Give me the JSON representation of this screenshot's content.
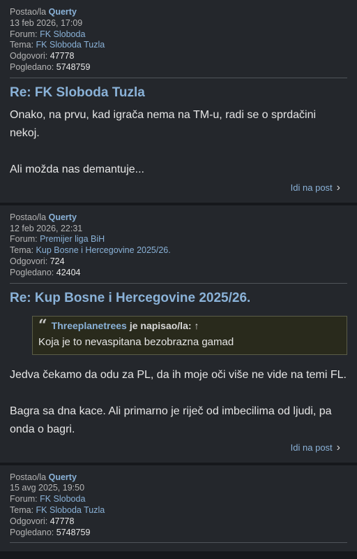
{
  "labels": {
    "posted_by": "Postao/la",
    "forum": "Forum:",
    "topic": "Tema:",
    "replies": "Odgovori:",
    "views": "Pogledano:",
    "goto": "Idi na post",
    "wrote": "je napisao/la:"
  },
  "posts": [
    {
      "author": "Querty",
      "date": "13 feb 2026, 17:09",
      "forum": "FK Sloboda",
      "topic": "FK Sloboda Tuzla",
      "replies": "47778",
      "views": "5748759",
      "title": "Re: FK Sloboda Tuzla",
      "body": [
        "Onako, na prvu, kad igrača nema na TM-u, radi se o sprdačini nekoj.",
        "Ali možda nas demantuje..."
      ]
    },
    {
      "author": "Querty",
      "date": "12 feb 2026, 22:31",
      "forum": "Premijer liga BiH",
      "topic": "Kup Bosne i Hercegovine 2025/26.",
      "replies": "724",
      "views": "42404",
      "title": "Re: Kup Bosne i Hercegovine 2025/26.",
      "quote": {
        "author": "Threeplanetrees",
        "text": "Koja je to nevaspitana bezobrazna gamad"
      },
      "body": [
        "Jedva čekamo da odu za PL, da ih moje oči više ne vide na temi FL.",
        "Bagra sa dna kace. Ali primarno je riječ od imbecilima od ljudi, pa onda o bagri."
      ]
    },
    {
      "author": "Querty",
      "date": "15 avg 2025, 19:50",
      "forum": "FK Sloboda",
      "topic": "FK Sloboda Tuzla",
      "replies": "47778",
      "views": "5748759"
    }
  ]
}
